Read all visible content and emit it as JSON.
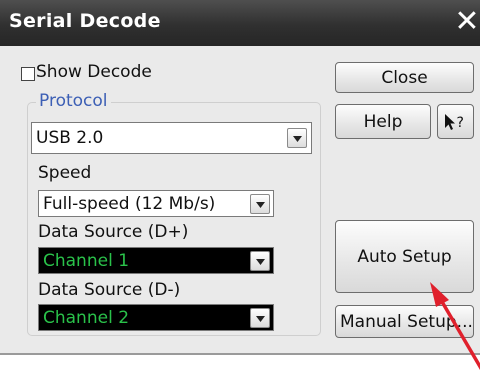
{
  "dialog": {
    "title": "Serial Decode",
    "close_glyph": "✕"
  },
  "show_decode": {
    "label": "Show Decode",
    "checked": false
  },
  "protocol": {
    "group_label": "Protocol",
    "value": "USB 2.0"
  },
  "speed": {
    "label": "Speed",
    "value": "Full-speed (12 Mb/s)"
  },
  "source_dp": {
    "label": "Data Source (D+)",
    "value": "Channel 1"
  },
  "source_dm": {
    "label": "Data Source (D-)",
    "value": "Channel 2"
  },
  "buttons": {
    "close": "Close",
    "help": "Help",
    "context_help_icon": "pointer-question-icon",
    "auto_setup": "Auto Setup",
    "manual_setup": "Manual Setup..."
  },
  "colors": {
    "titlebar": "#303030",
    "group_title": "#3c5fb5",
    "channel_text": "#2ac24a",
    "annotation_arrow": "#e0202c"
  }
}
